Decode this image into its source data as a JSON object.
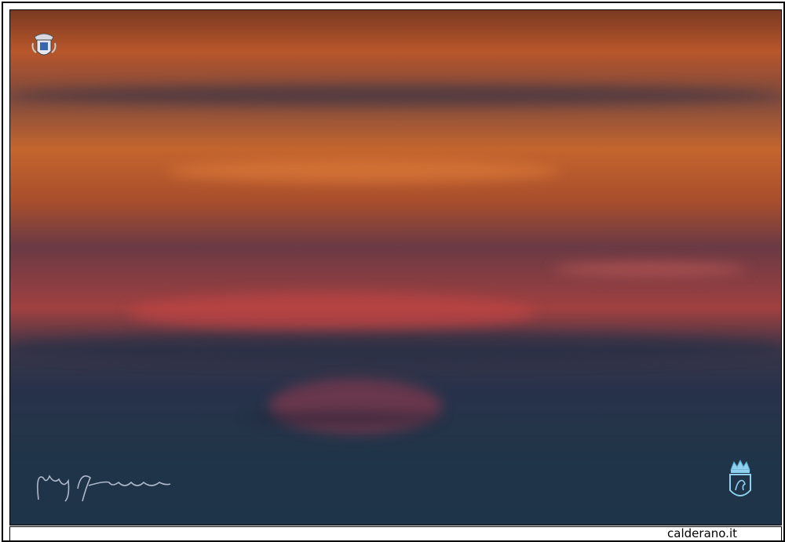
{
  "footer": {
    "site_label": "calderano.it"
  },
  "photo": {
    "subject": "sunset-over-sea",
    "emblems": [
      "coat-of-arms-icon",
      "crowned-shield-icon"
    ],
    "signature": "signature-icon"
  },
  "colors": {
    "sky_orange": "#c4652e",
    "sky_red": "#a04040",
    "sea_blue": "#21364a",
    "frame": "#000000"
  }
}
